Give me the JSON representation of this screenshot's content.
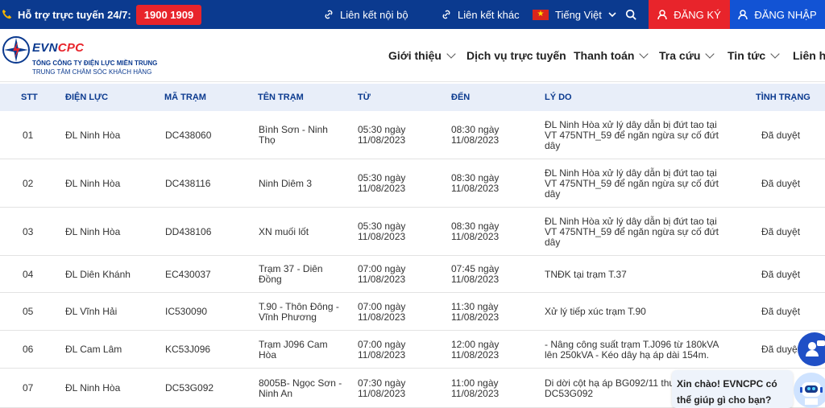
{
  "topbar": {
    "support_label": "Hỗ trợ trực tuyến 24/7:",
    "hotline": "1900 1909",
    "internal_link": "Liên kết nội bộ",
    "other_link": "Liên kết khác",
    "language": "Tiếng Việt",
    "register": "ĐĂNG KÝ",
    "login": "ĐĂNG NHẬP"
  },
  "brand": {
    "evn": "EVN",
    "cpc": "CPC",
    "line1": "TỔNG CÔNG TY ĐIỆN LỰC MIỀN TRUNG",
    "line2": "TRUNG TÂM CHĂM SÓC KHÁCH HÀNG"
  },
  "nav": [
    "Giới thiệu",
    "Dịch vụ trực tuyến",
    "Thanh toán",
    "Tra cứu",
    "Tin tức",
    "Liên hệ"
  ],
  "table": {
    "headers": [
      "STT",
      "ĐIỆN LỰC",
      "MÃ TRẠM",
      "TÊN TRẠM",
      "TỪ",
      "ĐẾN",
      "LÝ DO",
      "TÌNH TRẠNG"
    ],
    "rows": [
      {
        "stt": "01",
        "unit": "ĐL Ninh Hòa",
        "code": "DC438060",
        "name": [
          "Bình Sơn - Ninh",
          "Thọ"
        ],
        "from": [
          "05:30 ngày",
          "11/08/2023"
        ],
        "to": [
          "08:30 ngày",
          "11/08/2023"
        ],
        "reason": [
          "ĐL Ninh Hòa xử lý dây dẫn bị đứt tao tại",
          "VT 475NTH_59 để ngăn ngừa sự cố đứt",
          "dây"
        ],
        "status": "Đã duyệt"
      },
      {
        "stt": "02",
        "unit": "ĐL Ninh Hòa",
        "code": "DC438116",
        "name": [
          "Ninh Diêm 3"
        ],
        "from": [
          "05:30 ngày",
          "11/08/2023"
        ],
        "to": [
          "08:30 ngày",
          "11/08/2023"
        ],
        "reason": [
          "ĐL Ninh Hòa xử lý dây dẫn bị đứt tao tại",
          "VT 475NTH_59 để ngăn ngừa sự cố đứt",
          "dây"
        ],
        "status": "Đã duyệt"
      },
      {
        "stt": "03",
        "unit": "ĐL Ninh Hòa",
        "code": "DD438106",
        "name": [
          "XN muối lốt"
        ],
        "from": [
          "05:30 ngày",
          "11/08/2023"
        ],
        "to": [
          "08:30 ngày",
          "11/08/2023"
        ],
        "reason": [
          "ĐL Ninh Hòa xử lý dây dẫn bị đứt tao tại",
          "VT 475NTH_59 để ngăn ngừa sự cố đứt",
          "dây"
        ],
        "status": "Đã duyệt"
      },
      {
        "stt": "04",
        "unit": "ĐL Diên Khánh",
        "code": "EC430037",
        "name": [
          "Trạm 37 - Diên",
          "Đồng"
        ],
        "from": [
          "07:00 ngày",
          "11/08/2023"
        ],
        "to": [
          "07:45 ngày",
          "11/08/2023"
        ],
        "reason": [
          "TNĐK tại trạm T.37"
        ],
        "status": "Đã duyệt"
      },
      {
        "stt": "05",
        "unit": "ĐL Vĩnh Hải",
        "code": "IC530090",
        "name": [
          "T.90 - Thôn Đông -",
          "Vĩnh Phương"
        ],
        "from": [
          "07:00 ngày",
          "11/08/2023"
        ],
        "to": [
          "11:30 ngày",
          "11/08/2023"
        ],
        "reason": [
          "Xử lý tiếp xúc trạm T.90"
        ],
        "status": "Đã duyệt"
      },
      {
        "stt": "06",
        "unit": "ĐL Cam Lâm",
        "code": "KC53J096",
        "name": [
          "Trạm J096 Cam",
          "Hòa"
        ],
        "from": [
          "07:00 ngày",
          "11/08/2023"
        ],
        "to": [
          "12:00 ngày",
          "11/08/2023"
        ],
        "reason": [
          "- Nâng công suất trạm T.J096 từ 180kVA",
          "lên 250kVA - Kéo dây hạ áp dài 154m."
        ],
        "status": "Đã duyệt"
      },
      {
        "stt": "07",
        "unit": "ĐL Ninh Hòa",
        "code": "DC53G092",
        "name": [
          "8005B- Ngọc Sơn -",
          "Ninh An"
        ],
        "from": [
          "07:30 ngày",
          "11/08/2023"
        ],
        "to": [
          "11:00 ngày",
          "11/08/2023"
        ],
        "reason": [
          "Di dời cột hạ áp BG092/11 thu",
          "DC53G092"
        ],
        "status": ""
      }
    ]
  },
  "chat": {
    "line1": "Xin chào! EVNCPC có",
    "line2": "thể giúp gì cho bạn?"
  },
  "colors": {
    "primary": "#0b3a8f",
    "accent": "#e8242b",
    "login": "#1253d4",
    "table_head": "#e8eef9"
  }
}
